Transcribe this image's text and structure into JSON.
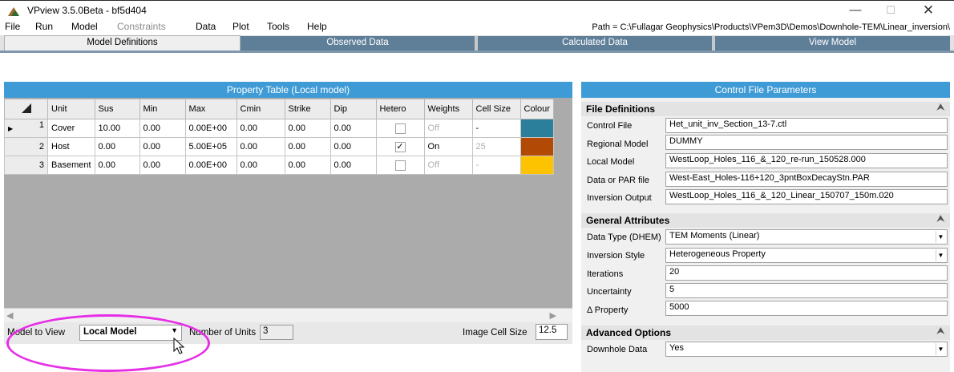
{
  "window": {
    "title": "VPview 3.5.0Beta - bf5d404",
    "minimize": "—",
    "maximize": "☐",
    "close": "✕"
  },
  "menu": {
    "items": [
      {
        "label": "File",
        "enabled": true
      },
      {
        "label": "Run",
        "enabled": true
      },
      {
        "label": "Model",
        "enabled": true
      },
      {
        "label": "Constraints",
        "enabled": false
      },
      {
        "label": "Data",
        "enabled": true
      },
      {
        "label": "Plot",
        "enabled": true
      },
      {
        "label": "Tools",
        "enabled": true
      },
      {
        "label": "Help",
        "enabled": true
      }
    ],
    "path": "Path = C:\\Fullagar Geophysics\\Products\\VPem3D\\Demos\\Downhole-TEM\\Linear_inversion\\"
  },
  "tabs": [
    {
      "label": "Model Definitions",
      "active": true
    },
    {
      "label": "Observed Data",
      "active": false
    },
    {
      "label": "Calculated Data",
      "active": false
    },
    {
      "label": "View Model",
      "active": false
    }
  ],
  "property_table": {
    "title": "Property Table (Local model)",
    "columns": [
      "Unit",
      "Sus",
      "Min",
      "Max",
      "Cmin",
      "Strike",
      "Dip",
      "Hetero",
      "Weights",
      "Cell Size",
      "Colour"
    ],
    "rows": [
      {
        "num": "1",
        "unit": "Cover",
        "sus": "10.00",
        "min": "0.00",
        "max": "0.00E+00",
        "cmin": "0.00",
        "strike": "0.00",
        "dip": "0.00",
        "hetero": false,
        "weights": "Off",
        "cell_size": "-",
        "colour": "#2c7f9b"
      },
      {
        "num": "2",
        "unit": "Host",
        "sus": "0.00",
        "min": "0.00",
        "max": "5.00E+05",
        "cmin": "0.00",
        "strike": "0.00",
        "dip": "0.00",
        "hetero": true,
        "weights": "On",
        "cell_size": "25",
        "colour": "#b24a06"
      },
      {
        "num": "3",
        "unit": "Basement",
        "sus": "0.00",
        "min": "0.00",
        "max": "0.00E+00",
        "cmin": "0.00",
        "strike": "0.00",
        "dip": "0.00",
        "hetero": false,
        "weights": "Off",
        "cell_size": "-",
        "colour": "#fdc300"
      }
    ]
  },
  "bottom_bar": {
    "model_to_view_label": "Model to View",
    "model_to_view_value": "Local Model",
    "units_label": "Number of Units",
    "units_value": "3",
    "cell_size_label": "Image Cell Size",
    "cell_size_value": "12.5"
  },
  "control_file": {
    "title": "Control File Parameters",
    "sections": [
      {
        "name": "File Definitions",
        "fields": [
          {
            "label": "Control File",
            "value": "Het_unit_inv_Section_13-7.ctl",
            "dropdown": false
          },
          {
            "label": "Regional Model",
            "value": "DUMMY",
            "dropdown": false
          },
          {
            "label": "Local Model",
            "value": "WestLoop_Holes_116_&_120_re-run_150528.000",
            "dropdown": false
          },
          {
            "label": "Data or PAR file",
            "value": "West-East_Holes-116+120_3pntBoxDecayStn.PAR",
            "dropdown": false
          },
          {
            "label": "Inversion Output",
            "value": "WestLoop_Holes_116_&_120_Linear_150707_150m.020",
            "dropdown": false
          }
        ]
      },
      {
        "name": "General Attributes",
        "fields": [
          {
            "label": "Data Type (DHEM)",
            "value": "TEM Moments (Linear)",
            "dropdown": true
          },
          {
            "label": "Inversion Style",
            "value": "Heterogeneous Property",
            "dropdown": true
          },
          {
            "label": "Iterations",
            "value": "20",
            "dropdown": false
          },
          {
            "label": "Uncertainty",
            "value": "5",
            "dropdown": false
          },
          {
            "label": "Δ Property",
            "value": "5000",
            "dropdown": false
          }
        ]
      },
      {
        "name": "Advanced Options",
        "fields": [
          {
            "label": "Downhole Data",
            "value": "Yes",
            "dropdown": true
          }
        ]
      }
    ]
  },
  "icons": {
    "app_logo": "app-logo-icon",
    "row_pointer": "row-pointer-icon",
    "corner": "table-corner-icon",
    "collapse": "collapse-up-icon",
    "dropdown": "chevron-down-icon",
    "cursor": "mouse-cursor-icon",
    "check": "check-icon"
  },
  "colors": {
    "panel_header": "#3f9bd6",
    "tab_inactive": "#5f7f99",
    "highlight": "#e62ee6"
  }
}
